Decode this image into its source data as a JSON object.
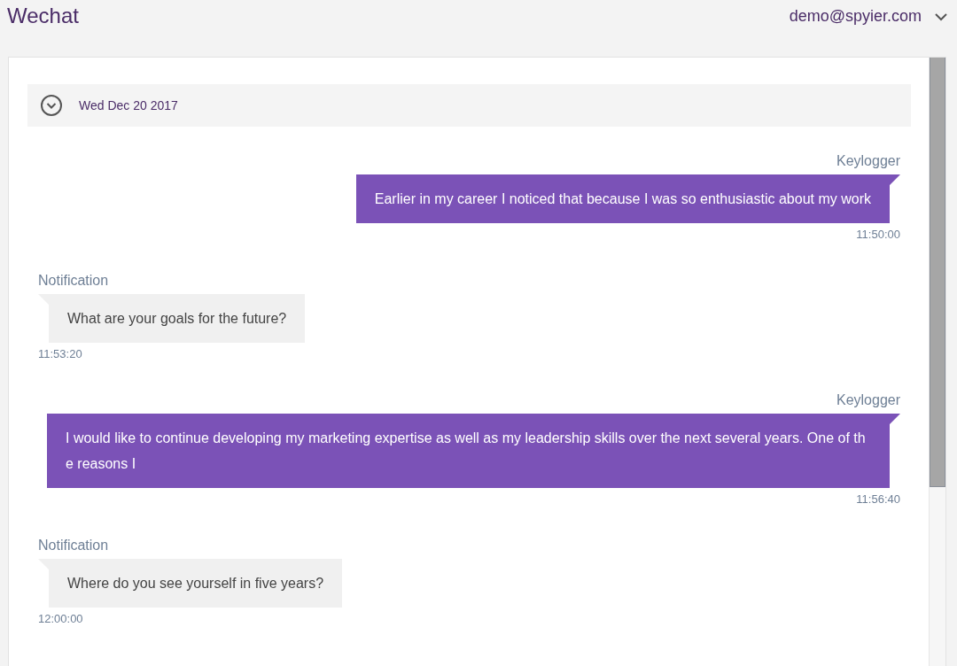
{
  "header": {
    "title": "Wechat",
    "account": "demo@spyier.com"
  },
  "date_group": {
    "label": "Wed Dec 20 2017",
    "expanded": true
  },
  "messages": [
    {
      "kind": "outgoing",
      "sender": "Keylogger",
      "text": "Earlier in my career I noticed that because I was so enthusiastic about my work",
      "time": "11:50:00"
    },
    {
      "kind": "incoming",
      "sender": "Notification",
      "text": "What are your goals for the future?",
      "time": "11:53:20"
    },
    {
      "kind": "outgoing",
      "sender": "Keylogger",
      "text": "I would like to continue developing my marketing expertise as well as my leadership skills over the next several years. One of the reasons I",
      "time": "11:56:40"
    },
    {
      "kind": "incoming",
      "sender": "Notification",
      "text": "Where do you see yourself in five years?",
      "time": "12:00:00"
    }
  ]
}
